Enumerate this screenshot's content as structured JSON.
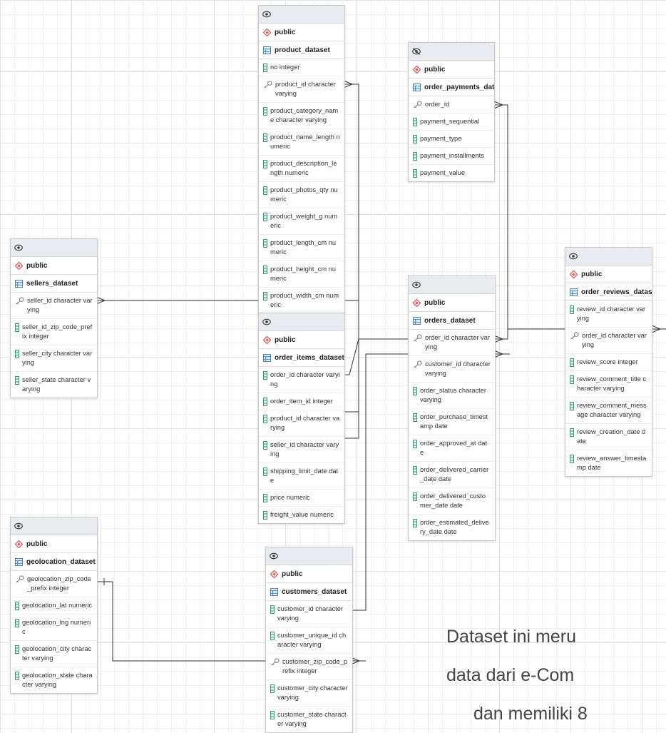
{
  "tables": [
    {
      "id": "product",
      "schema": "public",
      "name": "product_dataset",
      "columns": [
        {
          "key": false,
          "text": "no integer"
        },
        {
          "key": true,
          "text": "product_id character varying"
        },
        {
          "key": false,
          "text": "product_category_name character varying"
        },
        {
          "key": false,
          "text": "product_name_length numeric"
        },
        {
          "key": false,
          "text": "product_description_length numeric"
        },
        {
          "key": false,
          "text": "product_photos_qty numeric"
        },
        {
          "key": false,
          "text": "product_weight_g numeric"
        },
        {
          "key": false,
          "text": "product_length_cm numeric"
        },
        {
          "key": false,
          "text": "product_height_cm numeric"
        },
        {
          "key": false,
          "text": "product_width_cm numeric"
        }
      ]
    },
    {
      "id": "payments",
      "schema": "public",
      "name": "order_payments_dataset",
      "head_icon": "eye-slash-icon",
      "columns": [
        {
          "key": true,
          "text": "order_id"
        },
        {
          "key": false,
          "text": "payment_sequential"
        },
        {
          "key": false,
          "text": "payment_type"
        },
        {
          "key": false,
          "text": "payment_installments"
        },
        {
          "key": false,
          "text": "payment_value"
        }
      ]
    },
    {
      "id": "sellers",
      "schema": "public",
      "name": "sellers_dataset",
      "columns": [
        {
          "key": true,
          "text": "seller_id character varying"
        },
        {
          "key": false,
          "text": "seller_id_zip_code_prefix integer"
        },
        {
          "key": false,
          "text": "seller_city character varying"
        },
        {
          "key": false,
          "text": "seller_state character varying"
        }
      ]
    },
    {
      "id": "items",
      "schema": "public",
      "name": "order_items_dataset",
      "columns": [
        {
          "key": false,
          "text": "order_id character varying"
        },
        {
          "key": false,
          "text": "order_item_id integer"
        },
        {
          "key": false,
          "text": "product_id character varying"
        },
        {
          "key": false,
          "text": "seller_id character varying"
        },
        {
          "key": false,
          "text": "shipping_limit_date date"
        },
        {
          "key": false,
          "text": "price numeric"
        },
        {
          "key": false,
          "text": "freight_value numeric"
        }
      ]
    },
    {
      "id": "orders",
      "schema": "public",
      "name": "orders_dataset",
      "columns": [
        {
          "key": true,
          "text": "order_id character varying"
        },
        {
          "key": true,
          "text": "customer_id character varying"
        },
        {
          "key": false,
          "text": "order_status character varying"
        },
        {
          "key": false,
          "text": "order_purchase_timestamp date"
        },
        {
          "key": false,
          "text": "order_approved_at date"
        },
        {
          "key": false,
          "text": "order_delivered_carrier_date date"
        },
        {
          "key": false,
          "text": "order_delivered_customer_date date"
        },
        {
          "key": false,
          "text": "order_estimated_delivery_date date"
        }
      ]
    },
    {
      "id": "reviews",
      "schema": "public",
      "name": "order_reviews_dataset",
      "columns": [
        {
          "key": false,
          "text": "review_id character varying"
        },
        {
          "key": true,
          "text": "order_id character varying"
        },
        {
          "key": false,
          "text": "review_score integer"
        },
        {
          "key": false,
          "text": "review_comment_title character varying"
        },
        {
          "key": false,
          "text": "review_comment_message character varying"
        },
        {
          "key": false,
          "text": "review_creation_date date"
        },
        {
          "key": false,
          "text": "review_answer_timestamp date"
        }
      ]
    },
    {
      "id": "geo",
      "schema": "public",
      "name": "geolocation_dataset",
      "columns": [
        {
          "key": true,
          "text": "geolocation_zip_code_prefix integer"
        },
        {
          "key": false,
          "text": "geolocation_lat numeric"
        },
        {
          "key": false,
          "text": "geolocation_lng numeric"
        },
        {
          "key": false,
          "text": "geolocation_city character varying"
        },
        {
          "key": false,
          "text": "geolocation_state character varying"
        }
      ]
    },
    {
      "id": "customers",
      "schema": "public",
      "name": "customers_dataset",
      "columns": [
        {
          "key": false,
          "text": "customer_id character varying"
        },
        {
          "key": false,
          "text": "customer_unique_id character varying"
        },
        {
          "key": true,
          "text": "customer_zip_code_prefix integer"
        },
        {
          "key": false,
          "text": "customer_city character varying"
        },
        {
          "key": false,
          "text": "customer_state character varying"
        }
      ]
    }
  ],
  "caption": {
    "line1": "Dataset ini meru",
    "line2": "data dari e-Com",
    "line3": "dan memiliki 8"
  },
  "colors": {
    "line": "#333333",
    "key_icon": "#888888",
    "col_icon": "#2e9e6a",
    "table_icon": "#3a78c3",
    "schema_icon": "#d9534f"
  }
}
